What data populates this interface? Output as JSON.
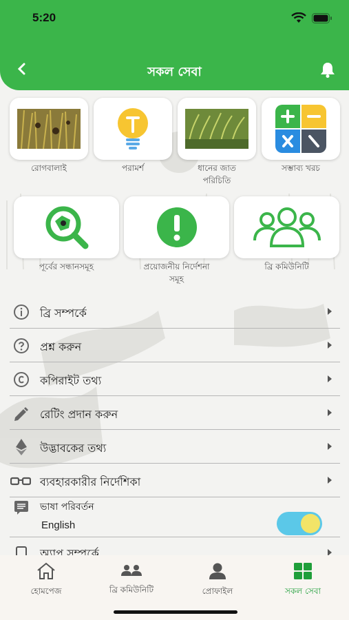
{
  "status_bar": {
    "time": "5:20"
  },
  "header": {
    "title": "সকল সেবা",
    "back_icon": "chevron-left-icon",
    "bell_icon": "bell-icon"
  },
  "top_tiles": [
    {
      "label": "রোগবালাই",
      "icon": "rice-disease-image"
    },
    {
      "label": "পরামর্শ",
      "icon": "lightbulb-icon"
    },
    {
      "label": "ধানের জাত\nপরিচিতি",
      "icon": "rice-field-image"
    },
    {
      "label": "সম্ভাব্য খরচ",
      "icon": "calculator-icon"
    }
  ],
  "mid_tiles": [
    {
      "label": "পূর্বের সন্ধানসমূহ",
      "icon": "search-history-icon"
    },
    {
      "label": "প্রয়োজনীয় নির্দেশনা\nসমূহ",
      "icon": "exclamation-icon"
    },
    {
      "label": "ব্রি কমিউনিটি",
      "icon": "community-icon"
    }
  ],
  "menu": [
    {
      "label": "ব্রি সম্পর্কে",
      "icon": "info-icon"
    },
    {
      "label": "প্রশ্ন করুন",
      "icon": "question-icon"
    },
    {
      "label": "কপিরাইট তথ্য",
      "icon": "copyright-icon"
    },
    {
      "label": "রেটিং প্রদান করুন",
      "icon": "pencil-icon"
    },
    {
      "label": "উদ্ভাবকের তথ্য",
      "icon": "ethereum-icon"
    },
    {
      "label": "ব্যবহারকারীর নির্দেশিকা",
      "icon": "glasses-icon"
    }
  ],
  "language": {
    "label": "ভাষা পরিবর্তন",
    "value": "English",
    "toggle_on": true
  },
  "about_app": {
    "label": "অ্যাপ সম্পর্কে"
  },
  "bottom_nav": [
    {
      "label": "হোমপেজ",
      "icon": "home-icon",
      "active": false
    },
    {
      "label": "ব্রি কমিউনিটি",
      "icon": "people-icon",
      "active": false
    },
    {
      "label": "প্রোফাইল",
      "icon": "profile-icon",
      "active": false
    },
    {
      "label": "সকল সেবা",
      "icon": "grid-icon",
      "active": true
    }
  ],
  "colors": {
    "primary": "#3bb54a",
    "toggle_track": "#5bc8e8",
    "toggle_knob": "#f2e468",
    "active_tab": "#1f9e3a"
  }
}
